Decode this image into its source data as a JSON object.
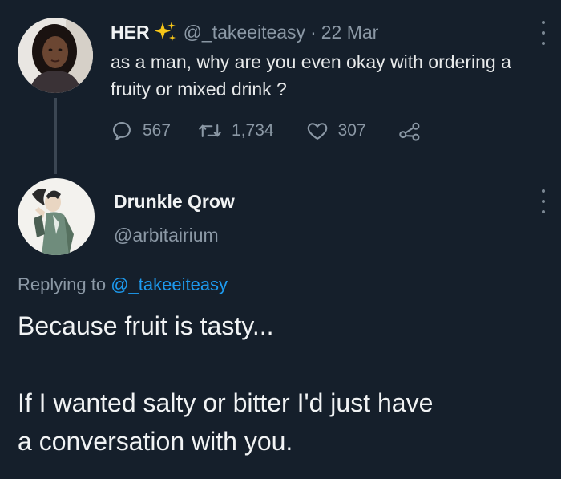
{
  "tweet": {
    "display_name": "HER",
    "handle": "@_takeeiteasy",
    "separator": "·",
    "date": "22 Mar",
    "text": "as a man, why are you even okay with ordering a fruity or mixed drink ?",
    "stats": {
      "replies": "567",
      "retweets": "1,734",
      "likes": "307"
    },
    "icons": {
      "name_badge": "sparkles-icon",
      "reply": "reply-icon",
      "retweet": "retweet-icon",
      "like": "heart-icon",
      "share": "share-icon",
      "more": "more-options-icon"
    }
  },
  "reply": {
    "display_name": "Drunkle Qrow",
    "handle": "@arbitairium",
    "replying_prefix": "Replying to",
    "replying_to": "@_takeeiteasy",
    "lines": [
      "Because fruit is tasty...",
      "If I wanted salty or bitter I'd just have",
      "a conversation with you."
    ]
  },
  "colors": {
    "background": "#151f2b",
    "text_primary": "#e7e9ea",
    "text_secondary": "#8b98a5",
    "link": "#1d9bf0",
    "sparkle": "#f5c518",
    "thread_line": "#3b4653"
  }
}
